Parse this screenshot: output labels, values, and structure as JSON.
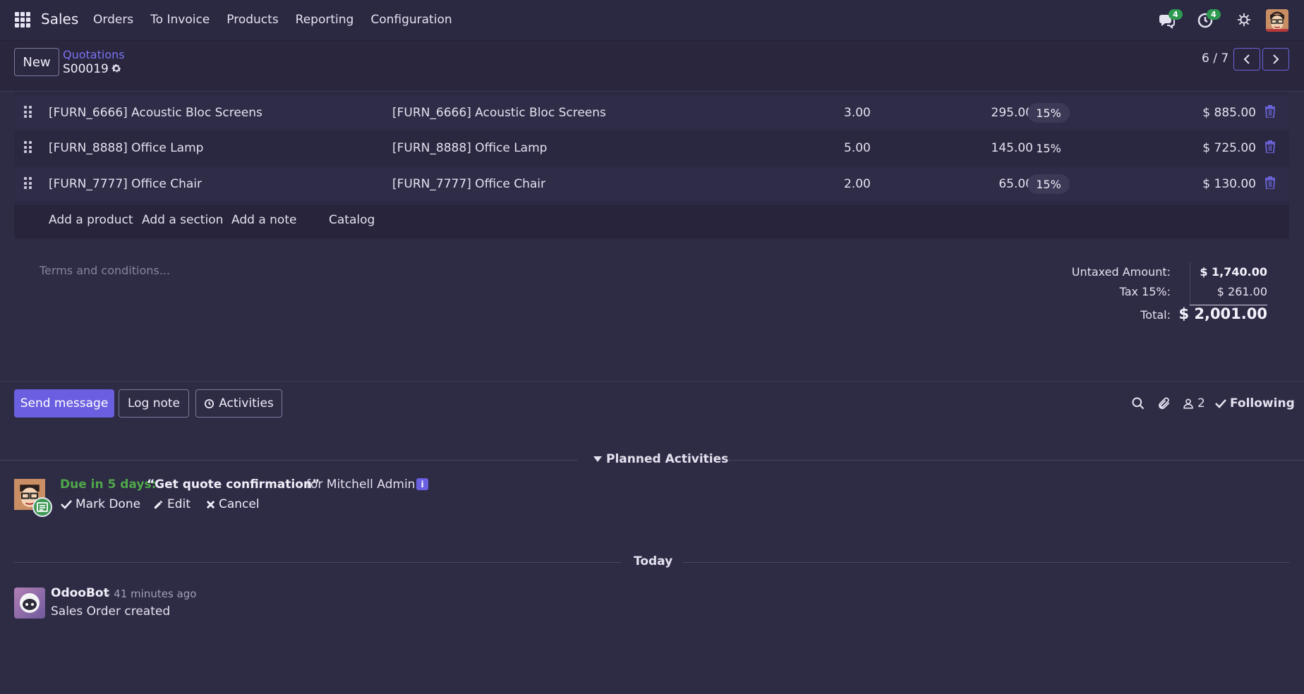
{
  "navbar": {
    "app_name": "Sales",
    "menu": [
      "Orders",
      "To Invoice",
      "Products",
      "Reporting",
      "Configuration"
    ],
    "messages_badge": "4",
    "activities_badge": "4"
  },
  "control_panel": {
    "new_label": "New",
    "breadcrumb": "Quotations",
    "record_name": "S00019",
    "pager": "6 / 7"
  },
  "order_lines": [
    {
      "product": "[FURN_6666] Acoustic Bloc Screens",
      "description": "[FURN_6666] Acoustic Bloc Screens",
      "quantity": "3.00",
      "unit_price": "295.00",
      "tax": "15%",
      "subtotal": "$ 885.00"
    },
    {
      "product": "[FURN_8888] Office Lamp",
      "description": "[FURN_8888] Office Lamp",
      "quantity": "5.00",
      "unit_price": "145.00",
      "tax": "15%",
      "subtotal": "$ 725.00"
    },
    {
      "product": "[FURN_7777] Office Chair",
      "description": "[FURN_7777] Office Chair",
      "quantity": "2.00",
      "unit_price": "65.00",
      "tax": "15%",
      "subtotal": "$ 130.00"
    }
  ],
  "add_links": {
    "product": "Add a product",
    "section": "Add a section",
    "note": "Add a note",
    "catalog": "Catalog"
  },
  "terms_placeholder": "Terms and conditions...",
  "totals": {
    "untaxed_label": "Untaxed Amount:",
    "untaxed_value": "$ 1,740.00",
    "tax_label": "Tax 15%:",
    "tax_value": "$ 261.00",
    "total_label": "Total:",
    "total_value": "$ 2,001.00"
  },
  "chatter": {
    "send_message": "Send message",
    "log_note": "Log note",
    "activities": "Activities",
    "followers_count": "2",
    "following": "Following",
    "planned_title": "Planned Activities",
    "activity": {
      "due": "Due in 5 days:",
      "summary": "“Get quote confirmation”",
      "assignee": "for Mitchell Admin",
      "mark_done": "Mark Done",
      "edit": "Edit",
      "cancel": "Cancel"
    },
    "today_label": "Today",
    "message": {
      "author": "OdooBot",
      "time": "- 41 minutes ago",
      "body": "Sales Order created"
    }
  }
}
